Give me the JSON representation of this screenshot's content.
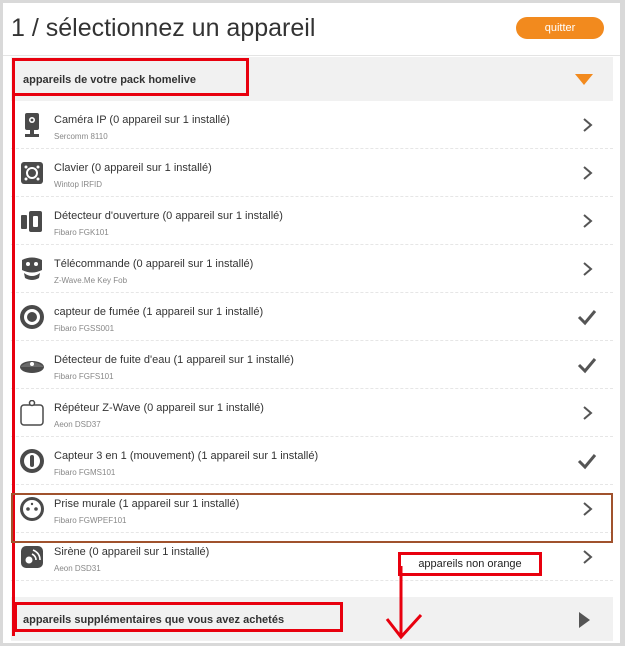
{
  "header": {
    "title": "1 / sélectionnez un appareil",
    "quit_label": "quitter"
  },
  "colors": {
    "accent": "#f28a1e",
    "annotation_red": "#e8000e",
    "annotation_brown": "#a0522d"
  },
  "sections": {
    "pack": {
      "label": "appareils de votre pack homelive",
      "toggle_icon": "chevron-down-icon"
    },
    "extra": {
      "label": "appareils supplémentaires que vous avez achetés",
      "toggle_icon": "chevron-right-icon"
    }
  },
  "devices": [
    {
      "title": "Caméra IP (0 appareil sur 1 installé)",
      "model": "Sercomm 8110",
      "icon": "camera-icon",
      "status": "arrow"
    },
    {
      "title": "Clavier (0 appareil sur 1 installé)",
      "model": "Wintop IRFID",
      "icon": "keypad-icon",
      "status": "arrow"
    },
    {
      "title": "Détecteur d'ouverture (0 appareil sur 1 installé)",
      "model": "Fibaro FGK101",
      "icon": "door-sensor-icon",
      "status": "arrow"
    },
    {
      "title": "Télécommande (0 appareil sur 1 installé)",
      "model": "Z-Wave.Me Key Fob",
      "icon": "remote-icon",
      "status": "arrow"
    },
    {
      "title": "capteur de fumée (1 appareil sur 1 installé)",
      "model": "Fibaro FGSS001",
      "icon": "smoke-detector-icon",
      "status": "check"
    },
    {
      "title": "Détecteur de fuite d'eau (1 appareil sur 1 installé)",
      "model": "Fibaro FGFS101",
      "icon": "flood-sensor-icon",
      "status": "check"
    },
    {
      "title": "Répéteur Z-Wave (0 appareil sur 1 installé)",
      "model": "Aeon DSD37",
      "icon": "repeater-icon",
      "status": "arrow"
    },
    {
      "title": "Capteur 3 en 1 (mouvement) (1 appareil sur 1 installé)",
      "model": "Fibaro FGMS101",
      "icon": "motion-sensor-icon",
      "status": "check"
    },
    {
      "title": "Prise murale (1 appareil sur 1 installé)",
      "model": "Fibaro FGWPEF101",
      "icon": "wall-plug-icon",
      "status": "arrow"
    },
    {
      "title": "Sirène (0 appareil sur 1 installé)",
      "model": "Aeon DSD31",
      "icon": "siren-icon",
      "status": "arrow"
    }
  ],
  "annotation": {
    "text": "appareils non orange"
  }
}
